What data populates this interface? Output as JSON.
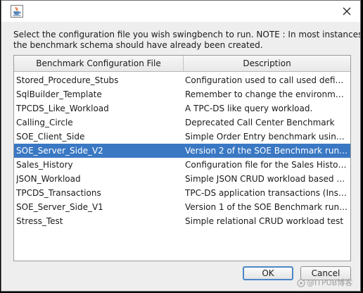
{
  "dialog": {
    "prompt_line1": "Select the configuration file you wish swingbench to run. NOTE : In most instances",
    "prompt_line2": "the benchmark schema should have already been created."
  },
  "icons": {
    "app": "java-cup-icon",
    "close": "close-icon"
  },
  "table": {
    "columns": [
      "Benchmark Configuration File",
      "Description"
    ],
    "selected_index": 5,
    "rows": [
      {
        "name": "Stored_Procedure_Stubs",
        "description": "Configuration used to call used define..."
      },
      {
        "name": "SqlBuilder_Template",
        "description": "Remember to change the environment..."
      },
      {
        "name": "TPCDS_Like_Workload",
        "description": "A TPC-DS like query workload."
      },
      {
        "name": "Calling_Circle",
        "description": "Deprecated Call Center Benchmark"
      },
      {
        "name": "SOE_Client_Side",
        "description": "Simple Order Entry benchmark using ..."
      },
      {
        "name": "SOE_Server_Side_V2",
        "description": "Version 2 of the SOE Benchmark runni..."
      },
      {
        "name": "Sales_History",
        "description": "Configuration file for the Sales History ..."
      },
      {
        "name": "JSON_Workload",
        "description": "Simple JSON CRUD workload based o..."
      },
      {
        "name": "TPCDS_Transactions",
        "description": "TPC-DS application transactions (Inser..."
      },
      {
        "name": "SOE_Server_Side_V1",
        "description": "Version 1 of the SOE Benchmark runni..."
      },
      {
        "name": "Stress_Test",
        "description": "Simple relational CRUD workload test"
      }
    ]
  },
  "buttons": {
    "ok": "OK",
    "cancel": "Cancel"
  },
  "watermark": "@ITPUB博客",
  "colors": {
    "selection": "#3a78c3",
    "default_button_border": "#4e86c8"
  }
}
